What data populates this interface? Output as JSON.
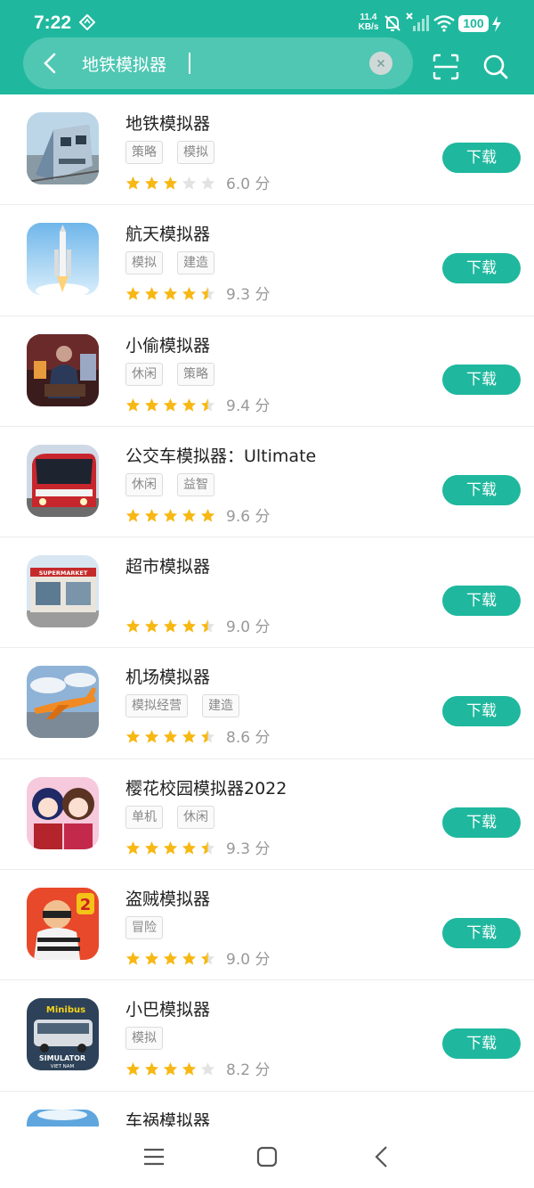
{
  "status_bar": {
    "time": "7:22",
    "net_speed": "11.4",
    "net_unit": "KB/s",
    "battery": "100",
    "icons": [
      "location-icon",
      "mute-icon",
      "no-signal-icon",
      "wifi-icon",
      "battery-icon",
      "charging-icon"
    ]
  },
  "search": {
    "query": "地铁模拟器",
    "back_icon": "chevron-left-icon",
    "clear_icon": "close-icon",
    "scan_icon": "scan-icon",
    "search_icon": "search-icon"
  },
  "colors": {
    "accent": "#1fb89e",
    "star": "#f7b814",
    "star_empty": "#e3e3e3"
  },
  "download_label": "下载",
  "apps": [
    {
      "name": "地铁模拟器",
      "tags": [
        "策略",
        "模拟"
      ],
      "rating": 3,
      "score": "6.0 分",
      "icon": "subway-train-icon"
    },
    {
      "name": "航天模拟器",
      "tags": [
        "模拟",
        "建造"
      ],
      "rating": 4.5,
      "score": "9.3 分",
      "icon": "rocket-icon"
    },
    {
      "name": "小偷模拟器",
      "tags": [
        "休闲",
        "策略"
      ],
      "rating": 4.5,
      "score": "9.4 分",
      "icon": "thief-icon"
    },
    {
      "name": "公交车模拟器：Ultimate",
      "tags": [
        "休闲",
        "益智"
      ],
      "rating": 5,
      "score": "9.6 分",
      "icon": "bus-icon"
    },
    {
      "name": "超市模拟器",
      "tags": [],
      "rating": 4.5,
      "score": "9.0 分",
      "icon": "supermarket-icon"
    },
    {
      "name": "机场模拟器",
      "tags": [
        "模拟经营",
        "建造"
      ],
      "rating": 4.5,
      "score": "8.6 分",
      "icon": "airplane-icon"
    },
    {
      "name": "樱花校园模拟器2022",
      "tags": [
        "单机",
        "休闲"
      ],
      "rating": 4.5,
      "score": "9.3 分",
      "icon": "anime-girls-icon"
    },
    {
      "name": "盗贼模拟器",
      "tags": [
        "冒险"
      ],
      "rating": 4.5,
      "score": "9.0 分",
      "icon": "robber-icon"
    },
    {
      "name": "小巴模拟器",
      "tags": [
        "模拟"
      ],
      "rating": 4,
      "score": "8.2 分",
      "icon": "minibus-icon"
    },
    {
      "name": "车祸模拟器",
      "tags": [],
      "rating": null,
      "score": null,
      "icon": "car-crash-icon"
    }
  ],
  "icon_texts": {
    "supermarket_sign": "SUPERMARKET",
    "minibus_logo": "Minibus",
    "minibus_sub1": "SIMULATOR",
    "minibus_sub2": "VIET NAM",
    "robber_badge": "2"
  },
  "nav_bar": {
    "icons": [
      "menu-icon",
      "home-icon",
      "back-icon"
    ]
  }
}
